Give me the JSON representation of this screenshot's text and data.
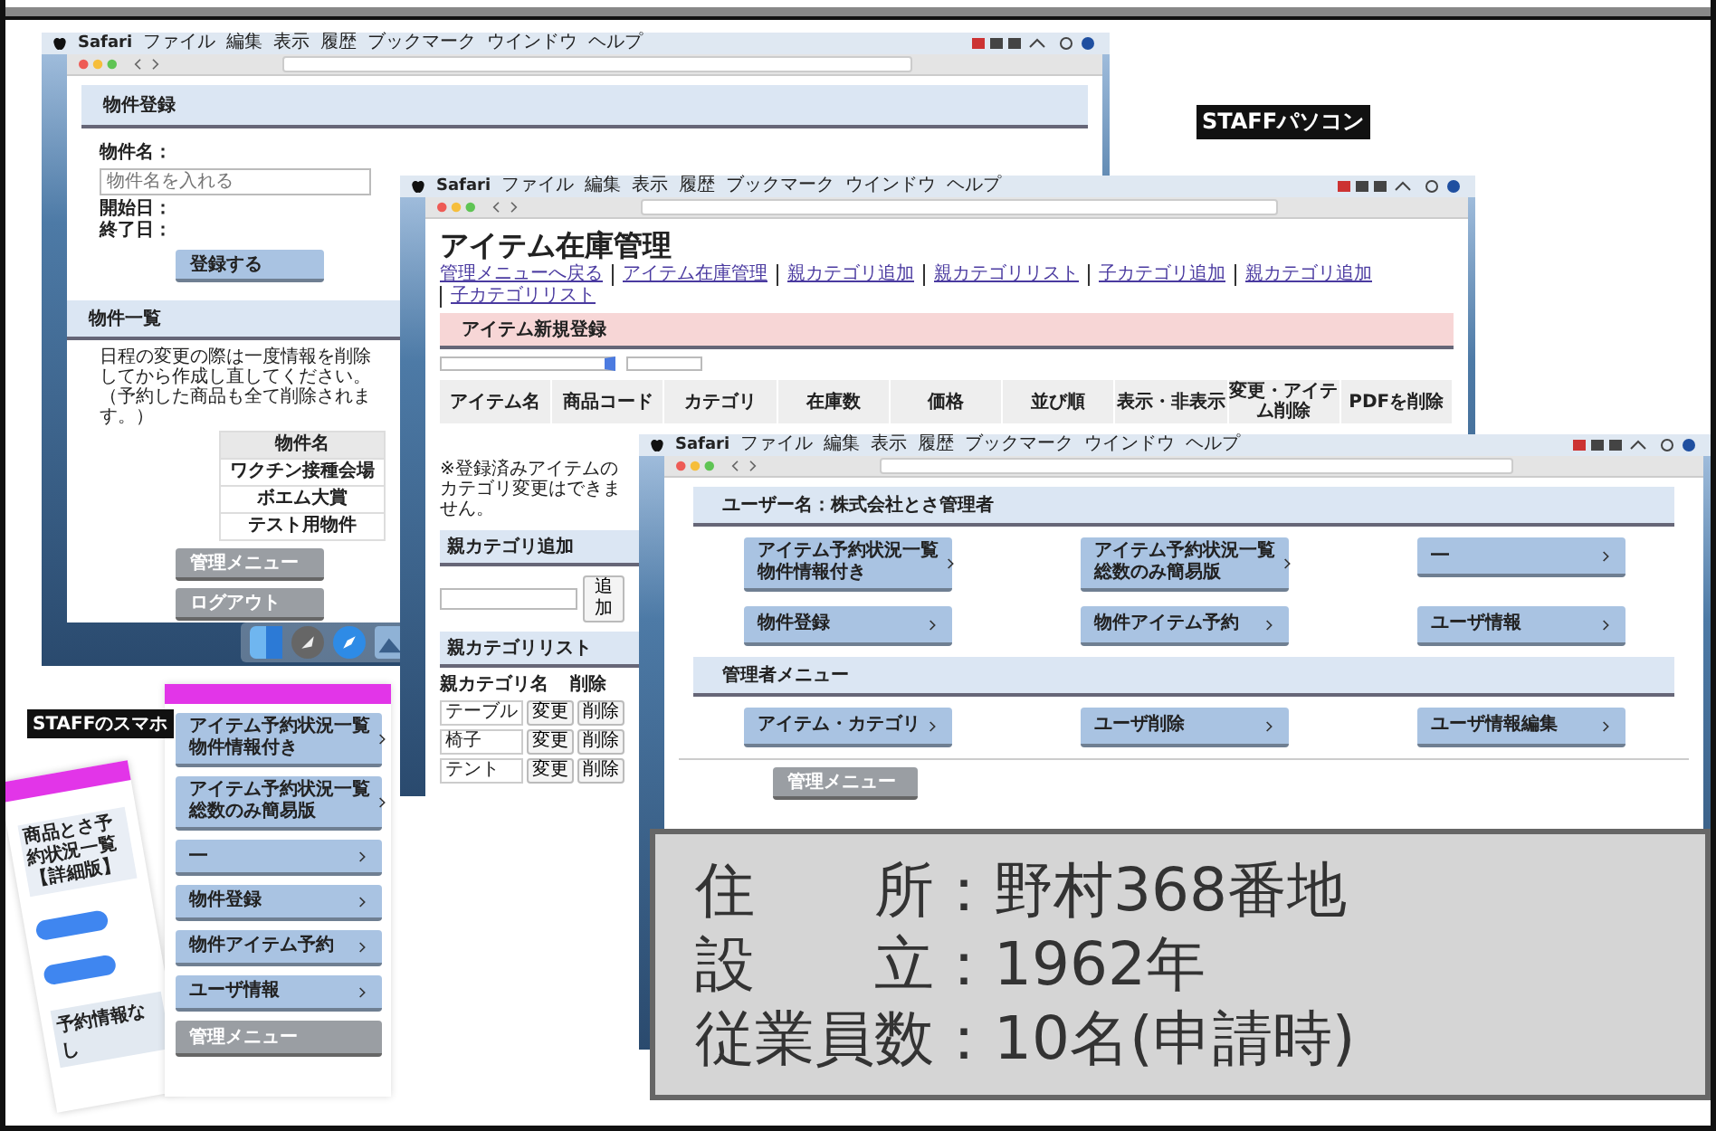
{
  "labels": {
    "pc": "STAFFパソコン",
    "phone": "STAFFのスマホ"
  },
  "window_1": {
    "menubar": {
      "app": "Safari",
      "items": [
        "ファイル",
        "編集",
        "表示",
        "履歴",
        "ブックマーク",
        "ウインドウ",
        "ヘルプ"
      ]
    },
    "title": "物件登録",
    "name_label": "物件名：",
    "name_placeholder": "物件名を入れる",
    "start_label": "開始日：",
    "end_label": "終了日：",
    "submit": "登録する",
    "list_title": "物件一覧",
    "note": "日程の変更の際は一度情報を削除してから作成し直してください。（予約した商品も全て削除されます。）",
    "table_header": "物件名",
    "rows": [
      "ワクチン接種会場",
      "ボエム大賞",
      "テスト用物件"
    ],
    "buttons": [
      "管理メニュー",
      "ログアウト"
    ]
  },
  "window_2": {
    "menubar": {
      "app": "Safari",
      "items": [
        "ファイル",
        "編集",
        "表示",
        "履歴",
        "ブックマーク",
        "ウインドウ",
        "ヘルプ"
      ]
    },
    "title": "アイテム在庫管理",
    "links": [
      "管理メニューへ戻る",
      "アイテム在庫管理",
      "親カテゴリ追加",
      "親カテゴリリスト",
      "子カテゴリ追加",
      "親カテゴリ追加",
      "子カテゴリリスト"
    ],
    "section": "アイテム新規登録",
    "columns": [
      "アイテム名",
      "商品コード",
      "カテゴリ",
      "在庫数",
      "価格",
      "並び順",
      "表示・非表示",
      "変更・アイテム削除",
      "PDFを削除"
    ],
    "note": "※登録済みアイテムのカテゴリ変更はできません。",
    "add_title": "親カテゴリ追加",
    "add_button": "追加",
    "list_title": "親カテゴリリスト",
    "list_columns": [
      "親カテゴリ名",
      "削除"
    ],
    "categories": [
      {
        "name": "テーブル",
        "edit": "変更",
        "delete": "削除"
      },
      {
        "name": "椅子",
        "edit": "変更",
        "delete": "削除"
      },
      {
        "name": "テント",
        "edit": "変更",
        "delete": "削除"
      }
    ]
  },
  "window_3": {
    "menubar": {
      "app": "Safari",
      "items": [
        "ファイル",
        "編集",
        "表示",
        "履歴",
        "ブックマーク",
        "ウインドウ",
        "ヘルプ"
      ]
    },
    "title": "ユーザー名：株式会社とさ管理者",
    "buttons": [
      [
        "アイテム予約状況一覧",
        "物件情報付き"
      ],
      [
        "アイテム予約状況一覧",
        "総数のみ簡易版"
      ],
      [
        "―"
      ],
      [
        "物件登録"
      ],
      [
        "物件アイテム予約"
      ],
      [
        "ユーザ情報"
      ]
    ],
    "admin_title": "管理者メニュー",
    "admin_buttons": [
      "アイテム・カテゴリ",
      "ユーザ削除",
      "ユーザ情報編集"
    ],
    "gray_button": "管理メニュー"
  },
  "phone": {
    "buttons": [
      [
        "アイテム予約状況一覧",
        "物件情報付き"
      ],
      [
        "アイテム予約状況一覧",
        "総数のみ簡易版"
      ],
      [
        "―"
      ],
      [
        "物件登録"
      ],
      [
        "物件アイテム予約"
      ],
      [
        "ユーザ情報"
      ]
    ],
    "gray_button": "管理メニュー"
  },
  "phone_tilted": {
    "title": "商品とさ予約状況一覧【詳細版】",
    "empty": "予約情報なし"
  },
  "info_box": [
    "住　　所：野村368番地",
    "設　　立：1962年",
    "従業員数：10名(申請時)"
  ]
}
